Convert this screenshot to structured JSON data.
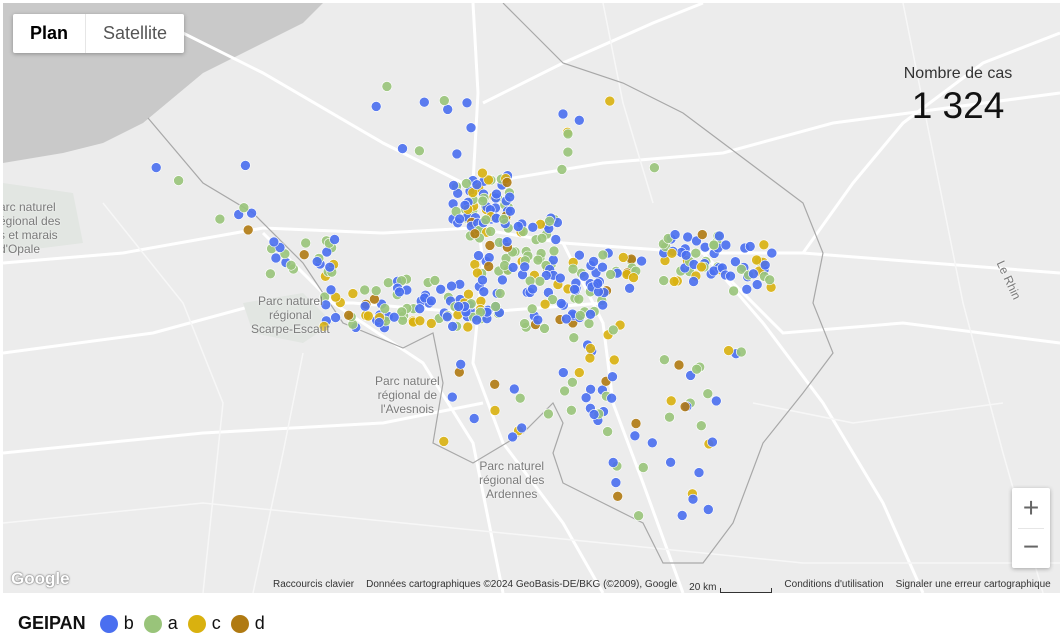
{
  "map_type_toggle": {
    "plan": "Plan",
    "satellite": "Satellite"
  },
  "case_count": {
    "label": "Nombre de cas",
    "value": "1 324"
  },
  "zoom": {
    "in": "+",
    "out": "−"
  },
  "google_logo": "Google",
  "attribution": {
    "shortcuts": "Raccourcis clavier",
    "data": "Données cartographiques ©2024 GeoBasis-DE/BKG (©2009), Google",
    "scale": "20 km",
    "terms": "Conditions d'utilisation",
    "report": "Signaler une erreur cartographique"
  },
  "map_labels": {
    "opale": "arc naturel\négional des\ns et marais\nd'Opale",
    "scarpe": "Parc naturel\nrégional\nScarpe-Escaut",
    "avesnois": "Parc naturel\nrégional de\nl'Avesnois",
    "ardennes": "Parc naturel\nrégional des\nArdennes",
    "rhin": "Le Rhin"
  },
  "legend": {
    "title": "GEIPAN",
    "items": [
      {
        "label": "b",
        "color": "#4a6ff0"
      },
      {
        "label": "a",
        "color": "#99c47a"
      },
      {
        "label": "c",
        "color": "#d9b10f"
      },
      {
        "label": "d",
        "color": "#b07a12"
      }
    ]
  },
  "colors": {
    "sea": "#c9c9c9",
    "land": "#ececec",
    "road": "#ffffff",
    "border": "#a8a8a8"
  }
}
